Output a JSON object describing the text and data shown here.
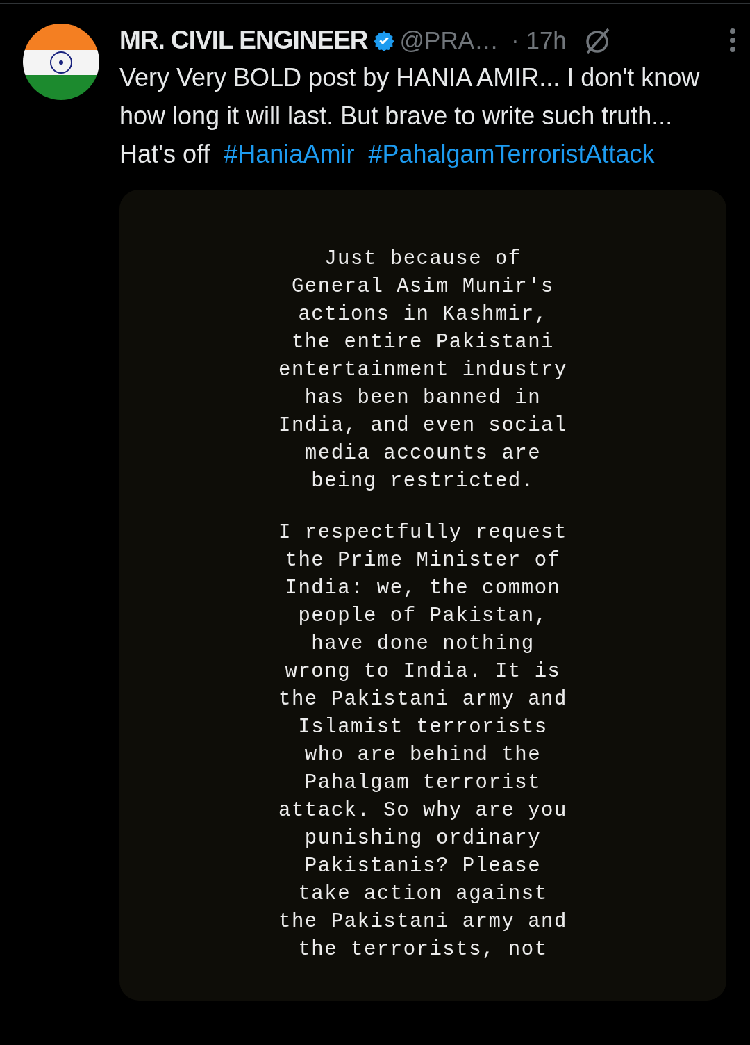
{
  "post": {
    "author": {
      "name": "MR. CIVIL ENGINEER",
      "verified": true,
      "handle": "@PRA…",
      "time": "· 17h"
    },
    "text": "Very Very BOLD post by HANIA AMIR... I don't know how long it will last. But brave to write such truth... Hat's off",
    "hashtags": [
      "#HaniaAmir",
      "#PahalgamTerroristAttack"
    ],
    "image": {
      "paragraphs": [
        {
          "lines": [
            "Just because of",
            "General Asim Munir's",
            "actions in Kashmir,",
            "the entire Pakistani",
            "entertainment industry",
            "has been banned in",
            "India, and even social",
            "media accounts are",
            "being restricted."
          ]
        },
        {
          "lines": [
            "I respectfully request",
            "the Prime Minister of",
            "India: we, the common",
            "people of Pakistan,",
            "have done nothing",
            "wrong to India. It is",
            "the Pakistani army and",
            "Islamist terrorists",
            "who are behind the",
            "Pahalgam terrorist",
            "attack. So why are you",
            "punishing ordinary",
            "Pakistanis? Please",
            "take action against",
            "the Pakistani army and",
            "the terrorists, not"
          ]
        }
      ]
    }
  }
}
